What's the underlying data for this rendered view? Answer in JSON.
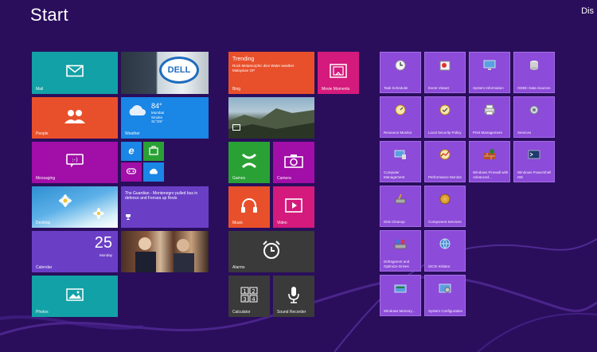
{
  "header": {
    "title": "Start",
    "user": "Dis"
  },
  "tiles": {
    "mail": "Mail",
    "dell": "DELL",
    "people": "People",
    "weather": {
      "label": "Weather",
      "temp": "84°",
      "info": "Mumbai\nSmoke\n31°/25°"
    },
    "messaging": "Messaging",
    "desktop": "Desktop",
    "news": {
      "text": "The Guardian - Montenegro pulled bus in defence and Ferrara up Reds"
    },
    "calendar": {
      "label": "Calendar",
      "number": "25",
      "day": "Monday"
    },
    "photos": "Photos",
    "trending": {
      "title": "Trending",
      "items": "Rock Metamorphic dies Water weather Malaysian GP",
      "label": "Bing"
    },
    "music_maker": "Movie Moments",
    "games": "Games",
    "camera": "Camera",
    "music": "Music",
    "video": "Video",
    "alarms": "Alarms",
    "calculator": "Calculator",
    "sound_recorder": "Sound Recorder"
  },
  "admin_tiles": [
    "Task Scheduler",
    "Event Viewer",
    "System Information",
    "ODBC Data Sources",
    "Resource Monitor",
    "Local Security Policy",
    "Print Management",
    "Services",
    "Computer Management",
    "Performance Monitor",
    "Windows Firewall with Advanced...",
    "Windows PowerShell ISE",
    "Disk Cleanup",
    "Component Services",
    "Defragment and Optimize Drives",
    "iSCSI Initiator",
    "Windows Memory...",
    "System Configuration"
  ],
  "colors": {
    "background": "#2a0e5c",
    "teal": "#12a1a6",
    "orange_red": "#e8502b",
    "blue": "#1a86e6",
    "magenta": "#a20ea8",
    "purple": "#6a3fc6",
    "green": "#2aa135",
    "pink": "#d41a7c",
    "dark_gray": "#3a3a3a",
    "admin": "#8c4bd8"
  }
}
